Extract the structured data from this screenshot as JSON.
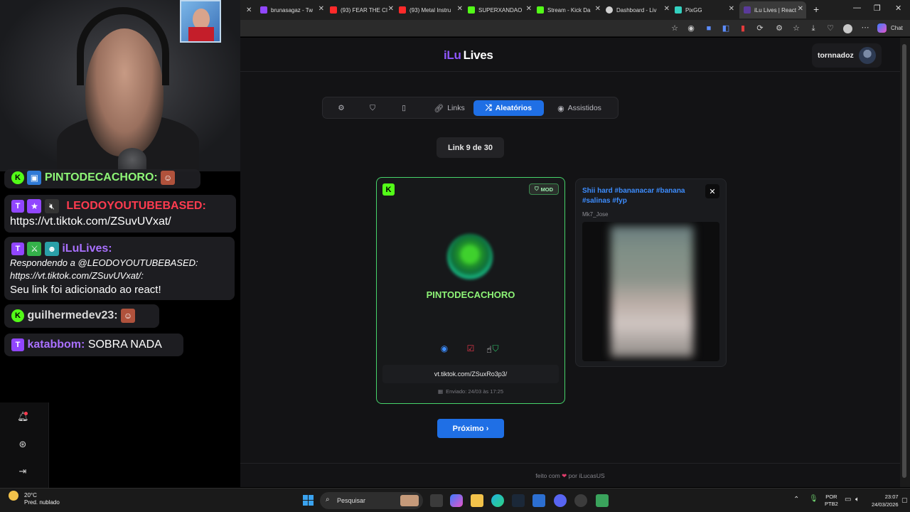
{
  "browser": {
    "tabs": [
      {
        "label": "brunasagaz - Tw",
        "fav_color": "#9146ff"
      },
      {
        "label": "(93) FEAR THE CI",
        "fav_color": "#ff2a2a"
      },
      {
        "label": "(93) Metal Instru",
        "fav_color": "#ff2a2a"
      },
      {
        "label": "SUPERXANDAO",
        "fav_color": "#53fc18"
      },
      {
        "label": "Stream - Kick Da",
        "fav_color": "#53fc18"
      },
      {
        "label": "Dashboard - Liv",
        "fav_color": "#d0d0d0"
      },
      {
        "label": "PixGG",
        "fav_color": "#33d1c0"
      },
      {
        "label": "iLu Lives | React",
        "fav_color": "#5a3a9a"
      }
    ],
    "chat_label": "Chat"
  },
  "app": {
    "logo_part1": "iLu",
    "logo_part2": "Lives",
    "user": "tornnadoz",
    "nav": {
      "links": "Links",
      "aleatorios": "Aleatórios",
      "assistidos": "Assistidos"
    },
    "counter": "Link 9 de 30",
    "card": {
      "platform": "K",
      "mod_badge": "MOD",
      "username": "PINTODECACHORO",
      "link": "vt.tiktok.com/ZSuxRo3p3/",
      "sent": "Enviado: 24/03 às 17:25"
    },
    "side": {
      "title": "Shii hard #bananacar #banana #salinas #fyp",
      "author": "Mk7_Jose"
    },
    "next": "Próximo ›",
    "footer_pre": "feito com",
    "footer_post": "por iLucasUS"
  },
  "chat": {
    "m1_name": "PINTODECACHORO:",
    "m2_name": "LEODOYOUTUBEBASED:",
    "m2_text": "https://vt.tiktok.com/ZSuvUVxat/",
    "m3_name": "iLuLives:",
    "m3_reply": "Respondendo a @LEODOYOUTUBEBASED: https://vt.tiktok.com/ZSuvUVxat/:",
    "m3_text": "Seu link foi adicionado ao react!",
    "m4_name": "guilhermedev23:",
    "m5_name": "katabbom:",
    "m5_text": "SOBRA NADA"
  },
  "taskbar": {
    "temp": "20°C",
    "weather": "Pred. nublado",
    "search": "Pesquisar",
    "lang1": "POR",
    "lang2": "PTB2",
    "time": "23:07",
    "date": "24/03/2026"
  },
  "colors": {
    "accent": "#1f6fe5",
    "kick": "#53fc18",
    "twitch": "#9146ff",
    "username_green": "#8ef577"
  }
}
